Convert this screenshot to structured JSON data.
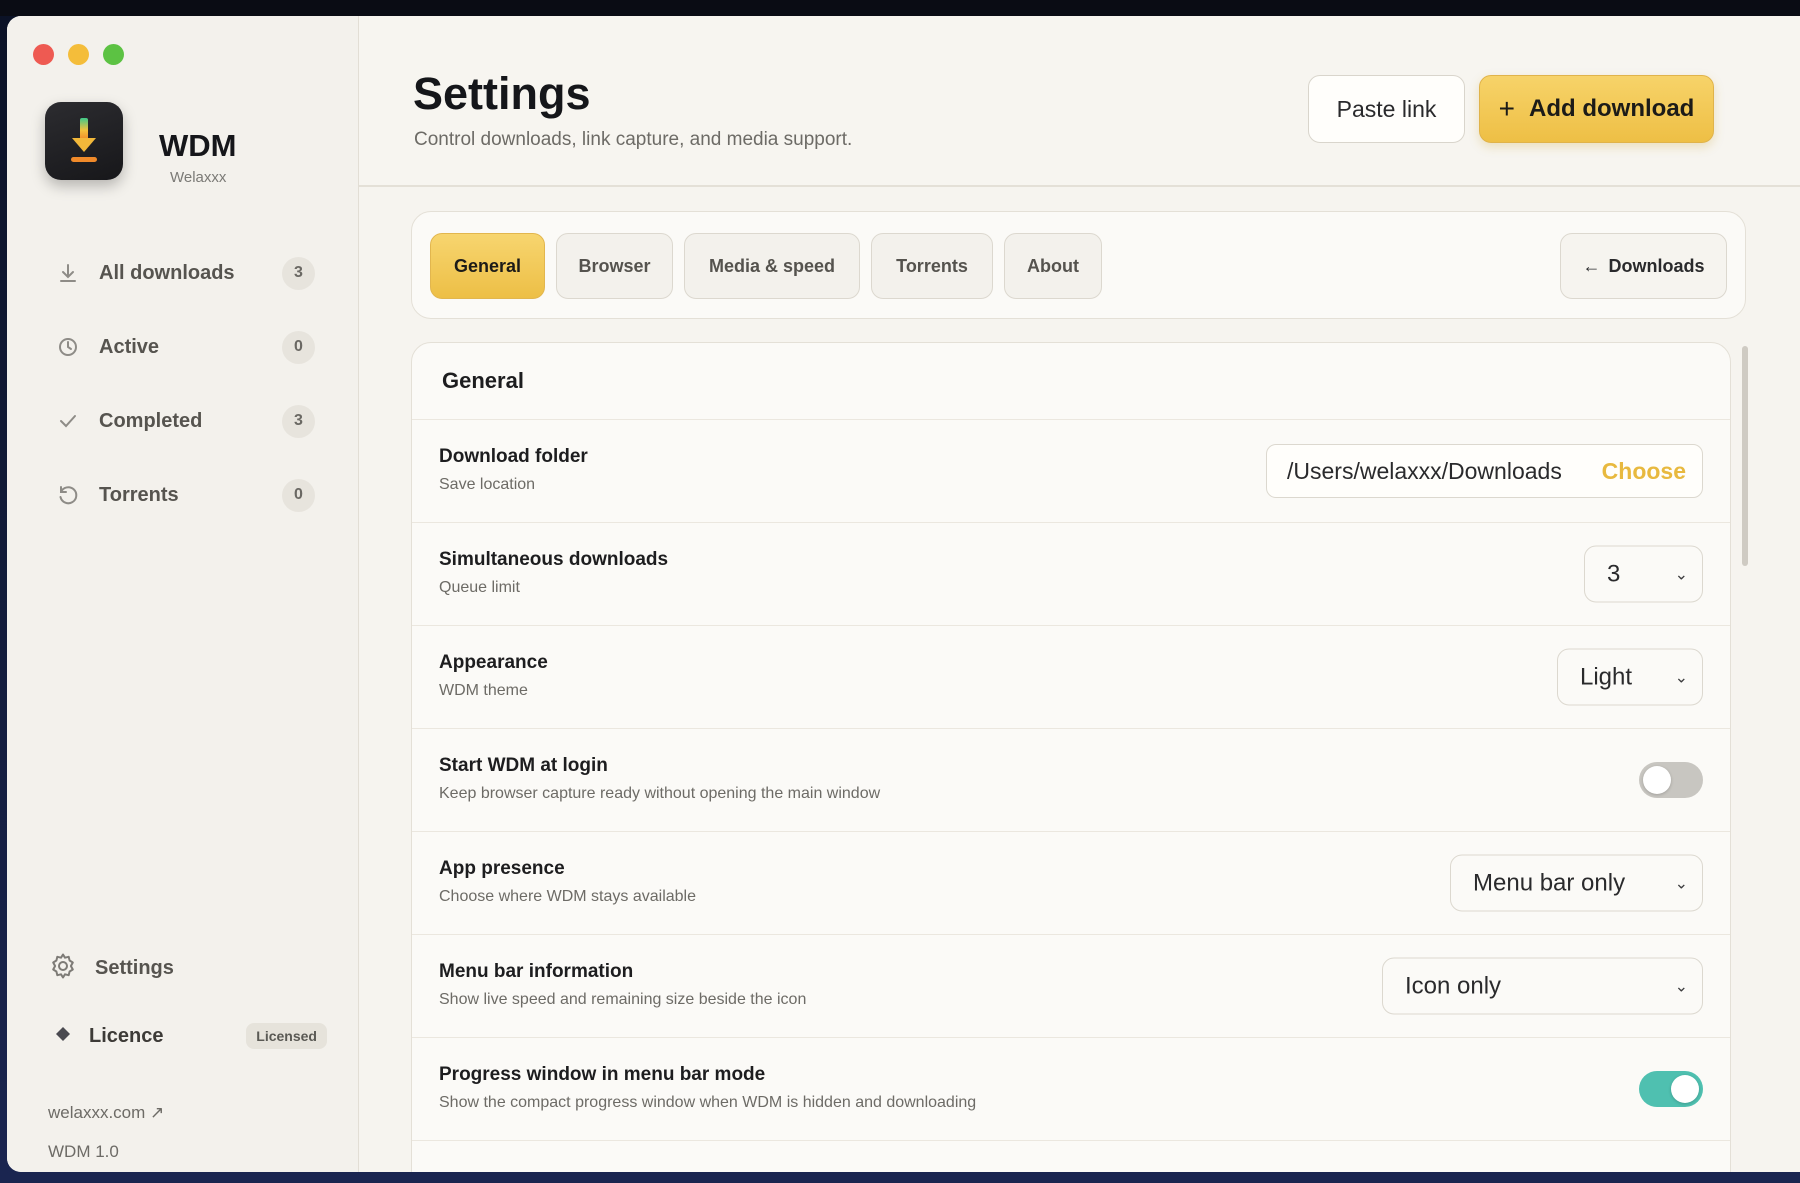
{
  "app": {
    "name": "WDM",
    "subtitle": "Welaxxx",
    "link": "welaxxx.com ↗",
    "version": "WDM 1.0"
  },
  "sidebar": {
    "items": [
      {
        "label": "All downloads",
        "count": "3",
        "icon": "download-icon"
      },
      {
        "label": "Active",
        "count": "0",
        "icon": "clock-icon"
      },
      {
        "label": "Completed",
        "count": "3",
        "icon": "check-icon"
      },
      {
        "label": "Torrents",
        "count": "0",
        "icon": "refresh-icon"
      }
    ],
    "settings_label": "Settings",
    "licence_label": "Licence",
    "licence_badge": "Licensed"
  },
  "header": {
    "title": "Settings",
    "subtitle": "Control downloads, link capture, and media support.",
    "paste_label": "Paste link",
    "add_label": "Add download"
  },
  "tabs": {
    "items": [
      "General",
      "Browser",
      "Media & speed",
      "Torrents",
      "About"
    ],
    "active": "General",
    "back_label": "Downloads"
  },
  "panel": {
    "title": "General",
    "rows": [
      {
        "label": "Download folder",
        "sub": "Save location",
        "value": "/Users/welaxxx/Downloads",
        "action": "Choose"
      },
      {
        "label": "Simultaneous downloads",
        "sub": "Queue limit",
        "value": "3"
      },
      {
        "label": "Appearance",
        "sub": "WDM theme",
        "value": "Light"
      },
      {
        "label": "Start WDM at login",
        "sub": "Keep browser capture ready without opening the main window",
        "toggle": false
      },
      {
        "label": "App presence",
        "sub": "Choose where WDM stays available",
        "value": "Menu bar only"
      },
      {
        "label": "Menu bar information",
        "sub": "Show live speed and remaining size beside the icon",
        "value": "Icon only"
      },
      {
        "label": "Progress window in menu bar mode",
        "sub": "Show the compact progress window when WDM is hidden and downloading",
        "toggle": true
      }
    ]
  },
  "colors": {
    "accent": "#eebf45",
    "toggle_on": "#4fc0b0"
  }
}
